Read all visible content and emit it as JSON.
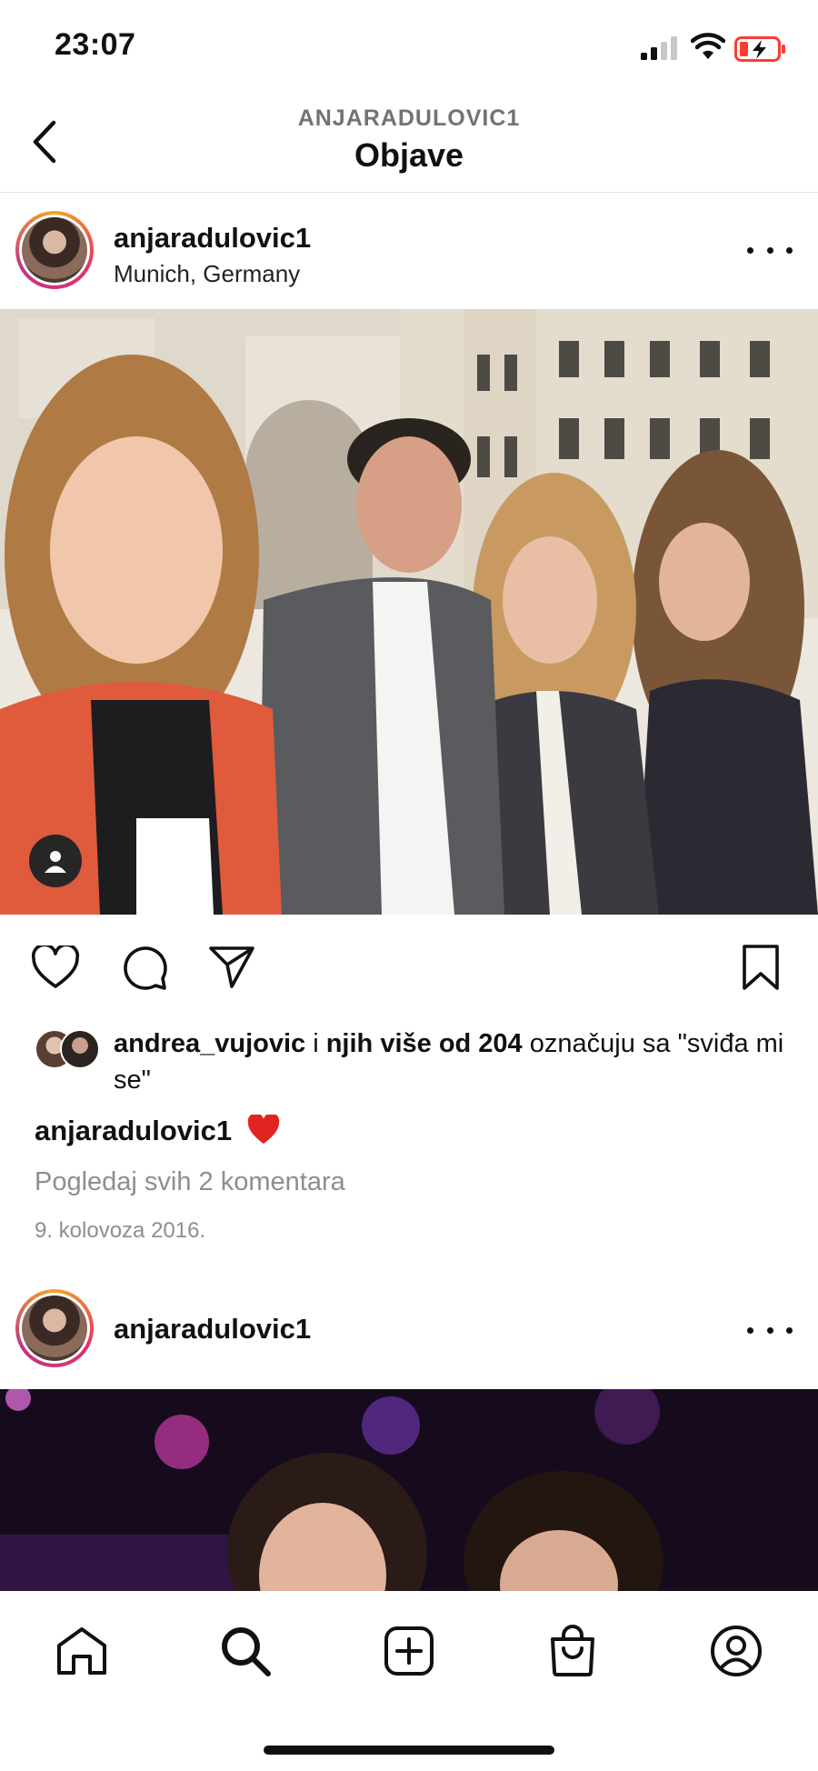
{
  "status_bar": {
    "time": "23:07",
    "icons": [
      "cellular-signal-icon",
      "wifi-icon",
      "battery-low-charging-icon"
    ],
    "battery_color": "#ff3b30"
  },
  "header": {
    "subtitle": "ANJARADULOVIC1",
    "title": "Objave",
    "back_icon": "chevron-left-icon"
  },
  "posts": [
    {
      "username": "anjaradulovic1",
      "location": "Munich, Germany",
      "more_icon": "more-horizontal-icon",
      "has_tagged_people": true,
      "actions": {
        "like_icon": "heart-icon",
        "comment_icon": "comment-icon",
        "share_icon": "send-icon",
        "save_icon": "bookmark-icon"
      },
      "likes": {
        "first_liker": "andrea_vujovic",
        "connector": " i ",
        "others": "njih više od 204",
        "suffix": " označuju sa \"sviđa mi se\""
      },
      "caption": {
        "username": "anjaradulovic1",
        "emoji": "red-heart-emoji"
      },
      "view_comments": "Pogledaj svih 2 komentara",
      "date": "9. kolovoza 2016."
    },
    {
      "username": "anjaradulovic1",
      "more_icon": "more-horizontal-icon"
    }
  ],
  "bottom_nav": {
    "items": [
      "home-icon",
      "search-icon",
      "new-post-icon",
      "shop-icon",
      "profile-icon"
    ]
  },
  "colors": {
    "accent_heart": "#ed4956",
    "secondary_text": "#8e8e8e",
    "story_ring": [
      "#f5a623",
      "#e1306c",
      "#c13584"
    ]
  }
}
